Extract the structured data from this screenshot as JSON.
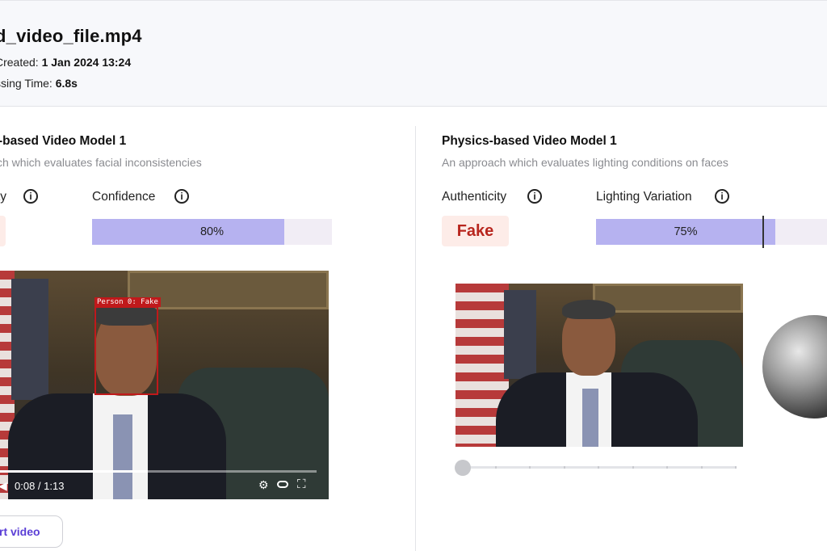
{
  "file": {
    "title": "d_video_file.mp4",
    "created_label": "Created:",
    "created_value": "1 Jan 2024 13:24",
    "processing_label": "ssing Time:",
    "processing_value": "6.8s"
  },
  "left_model": {
    "title": "-based Video Model 1",
    "description": "ch which evaluates facial inconsistencies",
    "authenticity_label": "ty",
    "confidence_label": "Confidence",
    "confidence_value": 0.8,
    "confidence_text": "80%",
    "detection_label": "Person 0: Fake",
    "time_text": "0:08 / 1:13",
    "playback_progress": 0.48,
    "export_button": "rt video"
  },
  "right_model": {
    "title": "Physics-based Video Model 1",
    "description": "An approach which evaluates lighting conditions on faces",
    "authenticity_label": "Authenticity",
    "authenticity_value": "Fake",
    "lighting_label": "Lighting Variation",
    "lighting_value": 0.75,
    "lighting_text": "75%",
    "slider_value": 0
  },
  "colors": {
    "bar_fill": "#b6b2f0",
    "bar_track": "#f1edf5",
    "fake_text": "#b8261e",
    "fake_bg": "#fdece8",
    "detect_box": "#c0191b",
    "accent": "#5b3fd6"
  },
  "icons": [
    "info-icon",
    "volume-icon",
    "settings-icon",
    "pip-icon",
    "fullscreen-icon"
  ]
}
